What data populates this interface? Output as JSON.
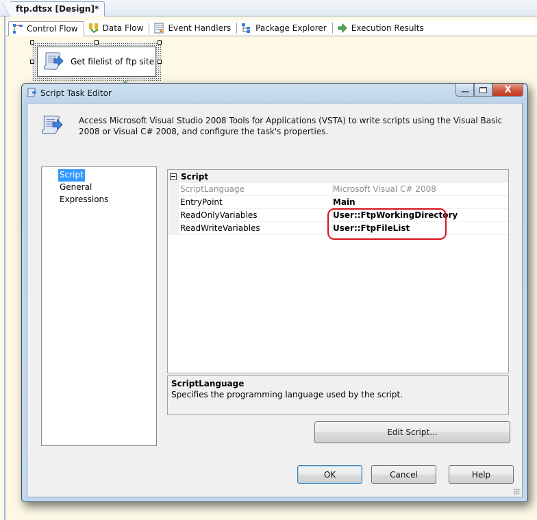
{
  "document_tab": {
    "title": "ftp.dtsx [Design]*"
  },
  "designer_tabs": [
    {
      "label": "Control Flow",
      "icon": "control-flow-icon",
      "active": true
    },
    {
      "label": "Data Flow",
      "icon": "data-flow-icon",
      "active": false
    },
    {
      "label": "Event Handlers",
      "icon": "event-handlers-icon",
      "active": false
    },
    {
      "label": "Package Explorer",
      "icon": "package-explorer-icon",
      "active": false
    },
    {
      "label": "Execution Results",
      "icon": "execution-results-icon",
      "active": false
    }
  ],
  "canvas": {
    "task": {
      "label": "Get filelist of ftp site",
      "icon": "script-task-icon"
    }
  },
  "dialog": {
    "title": "Script Task Editor",
    "window_buttons": {
      "minimize": "minimize",
      "maximize": "maximize",
      "close": "X"
    },
    "header_text": "Access Microsoft Visual Studio 2008 Tools for Applications (VSTA) to write scripts using the Visual Basic 2008 or Visual C# 2008, and configure the task's properties.",
    "nav_items": [
      {
        "label": "Script",
        "selected": true
      },
      {
        "label": "General",
        "selected": false
      },
      {
        "label": "Expressions",
        "selected": false
      }
    ],
    "property_grid": {
      "category": "Script",
      "rows": [
        {
          "name": "ScriptLanguage",
          "value": "Microsoft Visual C# 2008",
          "readonly": true,
          "bold": false
        },
        {
          "name": "EntryPoint",
          "value": "Main",
          "readonly": false,
          "bold": true
        },
        {
          "name": "ReadOnlyVariables",
          "value": "User::FtpWorkingDirectory",
          "readonly": false,
          "bold": true
        },
        {
          "name": "ReadWriteVariables",
          "value": "User::FtpFileList",
          "readonly": false,
          "bold": true
        }
      ],
      "highlight_color": "#d7121c"
    },
    "description": {
      "title": "ScriptLanguage",
      "text": "Specifies the programming language used by the script."
    },
    "buttons": {
      "edit_script": "Edit Script...",
      "ok": "OK",
      "cancel": "Cancel",
      "help": "Help"
    }
  }
}
